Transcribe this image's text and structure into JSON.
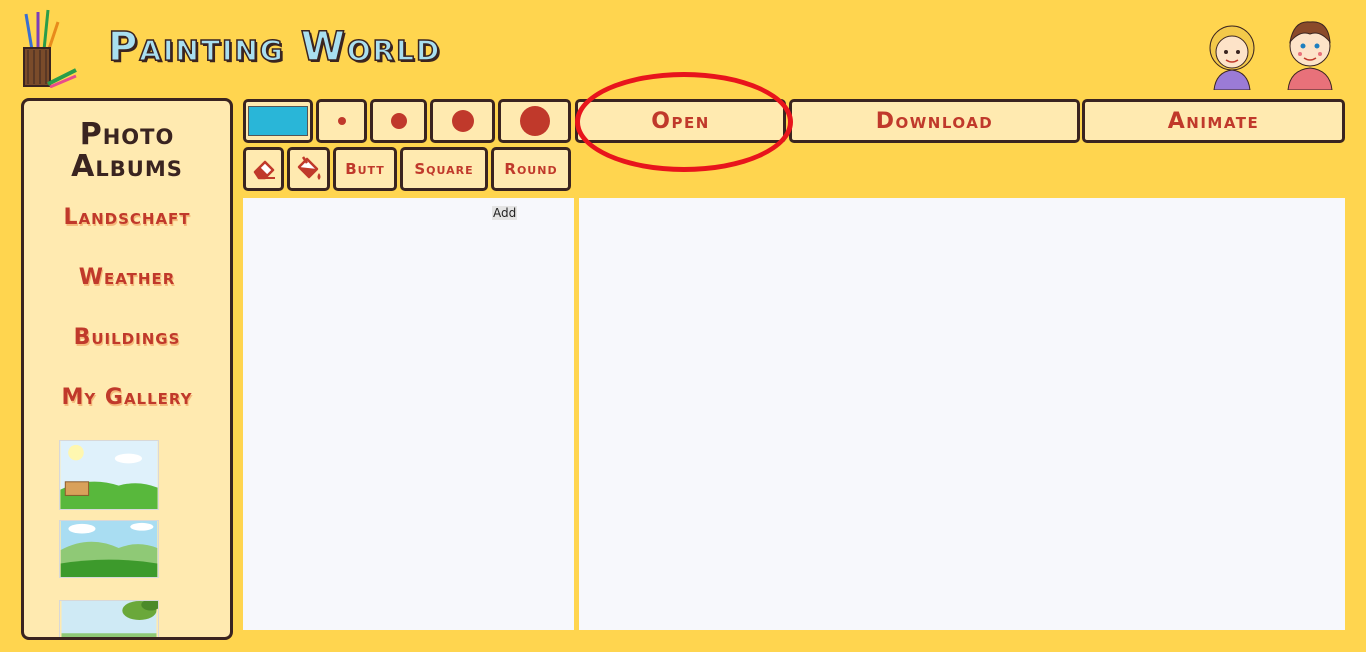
{
  "header": {
    "title": "Painting World",
    "logo_icon": "paint-brush-cup-icon",
    "avatars": [
      "girl-avatar",
      "boy-avatar"
    ]
  },
  "sidebar": {
    "title": "Photo Albums",
    "albums": [
      {
        "label": "Landschaft"
      },
      {
        "label": "Weather"
      },
      {
        "label": "Buildings"
      },
      {
        "label": "My Gallery"
      }
    ],
    "thumbnails": [
      "landscape-sun-sign",
      "landscape-hills-clouds",
      "landscape-tree-branch"
    ]
  },
  "toolbar": {
    "color": "#29b6d8",
    "brush_sizes": [
      "small",
      "medium",
      "large",
      "extra-large"
    ],
    "eraser_icon": "eraser-icon",
    "fill_icon": "paint-bucket-icon",
    "line_caps": {
      "butt": "Butt",
      "square": "Square",
      "round": "Round"
    },
    "open_label": "Open",
    "download_label": "Download",
    "animate_label": "Animate"
  },
  "layers": {
    "add_label": "Add"
  },
  "colors": {
    "background": "#ffd54f",
    "panel": "#ffeab0",
    "accent": "#c0392b",
    "outline": "#3a2420",
    "highlight": "#e8141c"
  }
}
